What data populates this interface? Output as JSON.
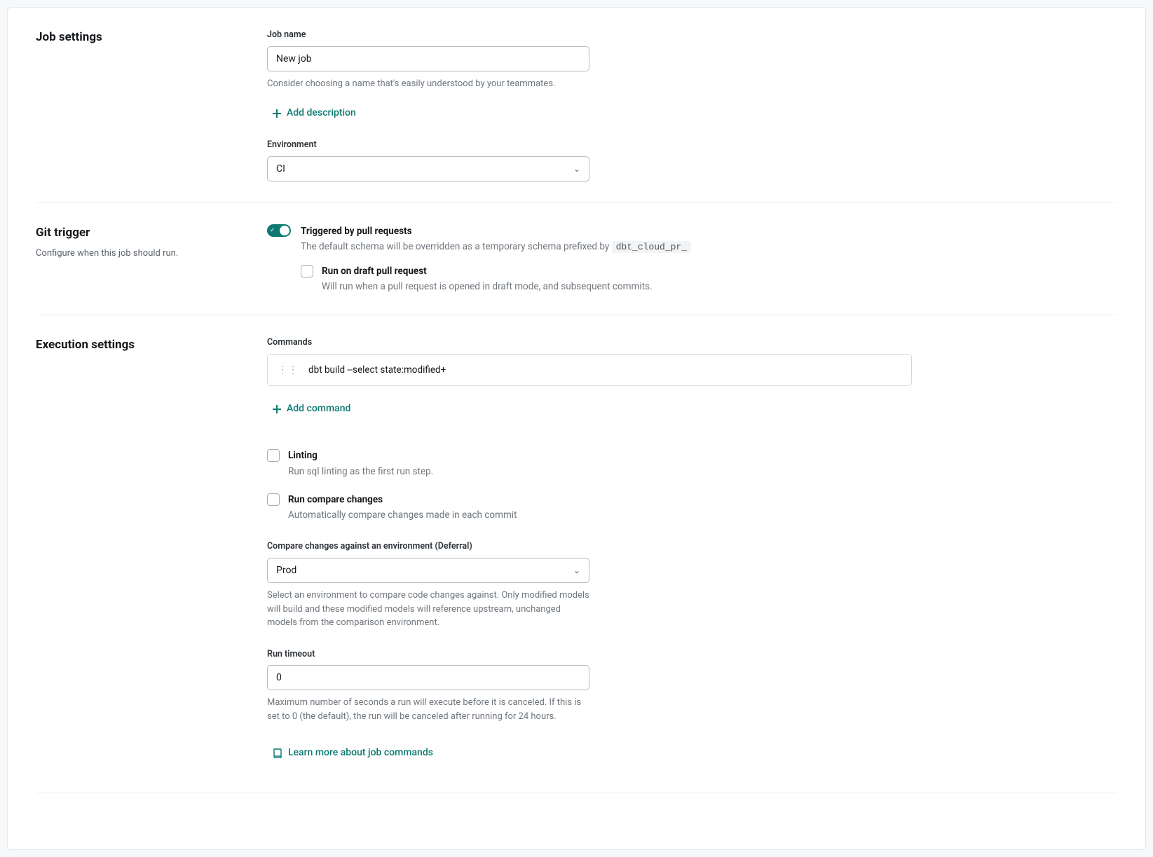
{
  "jobSettings": {
    "title": "Job settings",
    "jobNameLabel": "Job name",
    "jobNameValue": "New job",
    "jobNameHelper": "Consider choosing a name that's easily understood by your teammates.",
    "addDescription": "Add description",
    "environmentLabel": "Environment",
    "environmentValue": "CI"
  },
  "gitTrigger": {
    "title": "Git trigger",
    "subtitle": "Configure when this job should run.",
    "triggeredLabel": "Triggered by pull requests",
    "triggeredDescPrefix": "The default schema will be overridden as a temporary schema prefixed by ",
    "triggeredDescCode": "dbt_cloud_pr_",
    "draftLabel": "Run on draft pull request",
    "draftDesc": "Will run when a pull request is opened in draft mode, and subsequent commits."
  },
  "execution": {
    "title": "Execution settings",
    "commandsLabel": "Commands",
    "commandValue": "dbt build --select state:modified+",
    "addCommand": "Add command",
    "lintingLabel": "Linting",
    "lintingDesc": "Run sql linting as the first run step.",
    "compareLabel": "Run compare changes",
    "compareDesc": "Automatically compare changes made in each commit",
    "compareEnvLabel": "Compare changes against an environment (Deferral)",
    "compareEnvValue": "Prod",
    "compareEnvHelper": "Select an environment to compare code changes against. Only modified models will build and these modified models will reference upstream, unchanged models from the comparison environment.",
    "runTimeoutLabel": "Run timeout",
    "runTimeoutValue": "0",
    "runTimeoutHelper": "Maximum number of seconds a run will execute before it is canceled. If this is set to 0 (the default), the run will be canceled after running for 24 hours.",
    "learnMore": "Learn more about job commands"
  }
}
